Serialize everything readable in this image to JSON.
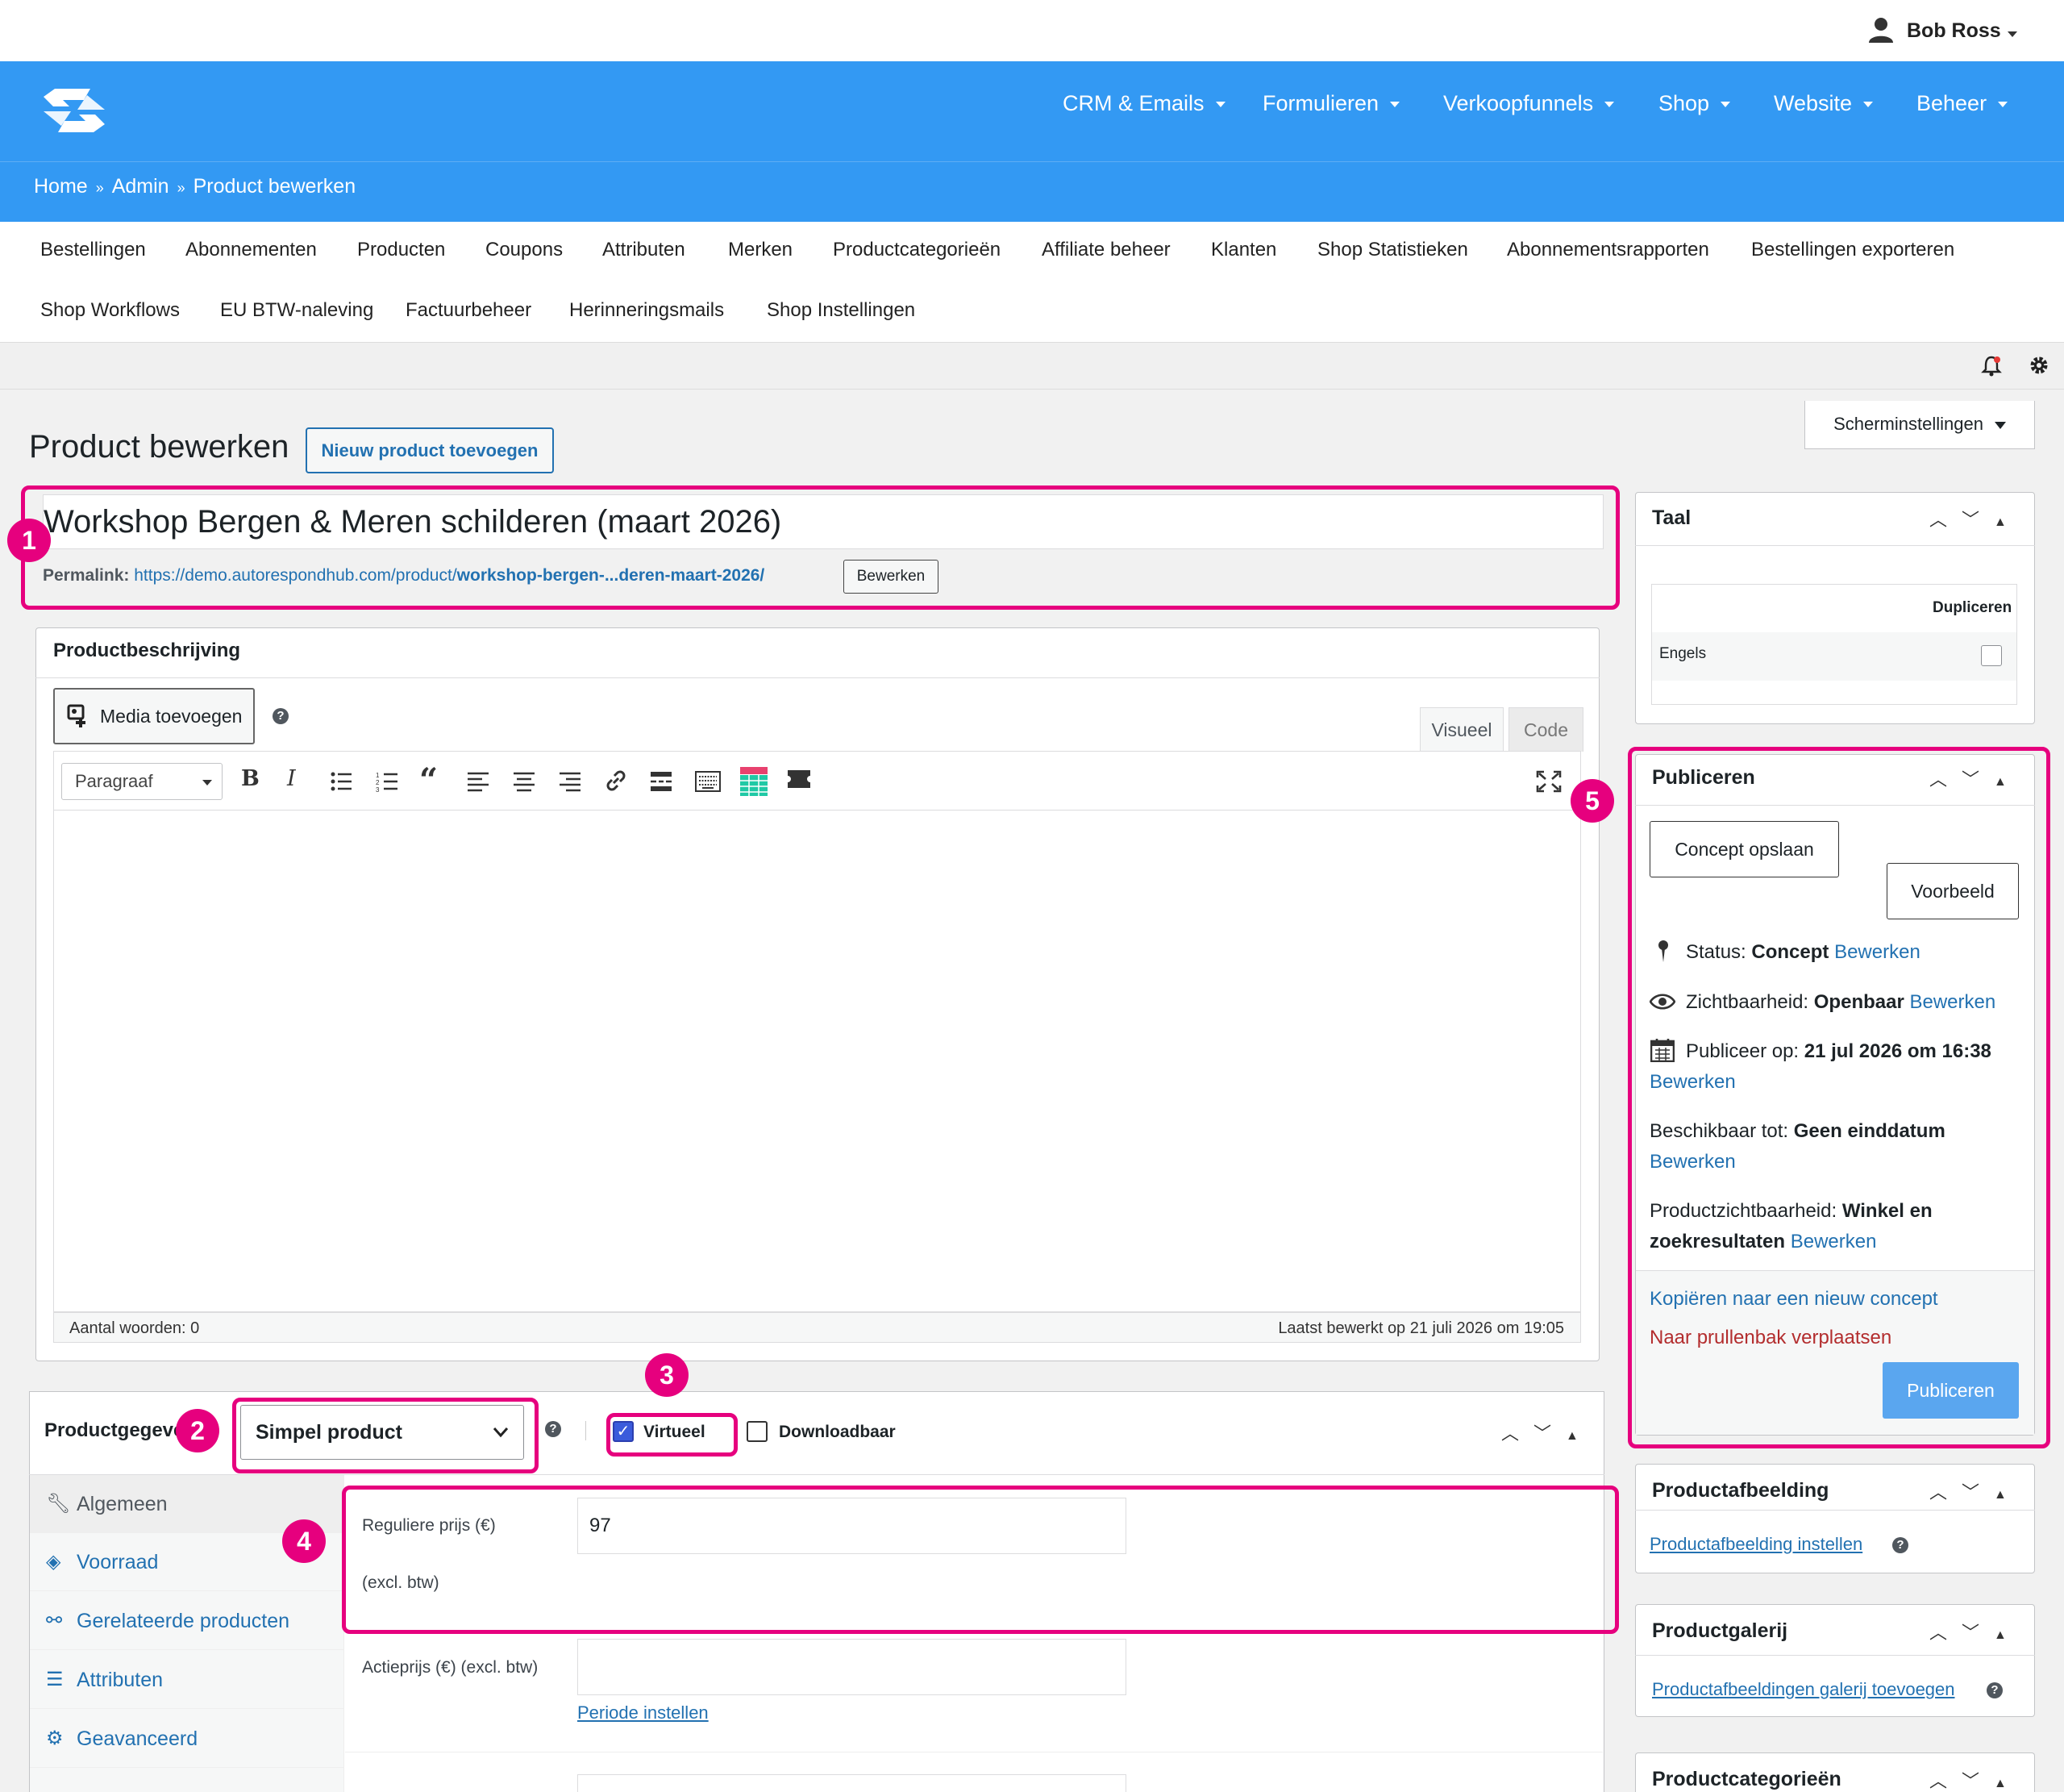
{
  "user": {
    "name": "Bob Ross"
  },
  "topnav": [
    "CRM & Emails",
    "Formulieren",
    "Verkoopfunnels",
    "Shop",
    "Website",
    "Beheer"
  ],
  "breadcrumb": {
    "home": "Home",
    "sep": "»",
    "admin": "Admin",
    "current": "Product bewerken"
  },
  "shopnav": {
    "row1": [
      "Bestellingen",
      "Abonnementen",
      "Producten",
      "Coupons",
      "Attributen",
      "Merken",
      "Productcategorieën",
      "Affiliate beheer",
      "Klanten",
      "Shop Statistieken",
      "Abonnementsrapporten",
      "Bestellingen exporteren"
    ],
    "row2": [
      "Shop Workflows",
      "EU BTW-naleving",
      "Factuurbeheer",
      "Herinneringsmails",
      "Shop Instellingen"
    ]
  },
  "screen_options": "Scherminstellingen",
  "page": {
    "title": "Product bewerken",
    "new_button": "Nieuw product toevoegen"
  },
  "product": {
    "title": "Workshop Bergen & Meren schilderen (maart 2026)",
    "permalink_label": "Permalink:",
    "permalink_base": "https://demo.autorespondhub.com/product/",
    "permalink_slug": "workshop-bergen-...deren-maart-2026/",
    "permalink_button": "Bewerken"
  },
  "description": {
    "heading": "Productbeschrijving",
    "media_button": "Media toevoegen",
    "tab_visual": "Visueel",
    "tab_code": "Code",
    "format": "Paragraaf",
    "word_count": "Aantal woorden: 0",
    "last_edited": "Laatst bewerkt op 21 juli 2026 om 19:05"
  },
  "product_data": {
    "heading": "Productgegevens",
    "type": "Simpel product",
    "virtual_label": "Virtueel",
    "virtual_checked": true,
    "downloadable_label": "Downloadbaar",
    "downloadable_checked": false,
    "tabs": [
      "Algemeen",
      "Voorraad",
      "Gerelateerde producten",
      "Attributen",
      "Geavanceerd"
    ],
    "regular_price_label": "Reguliere prijs (€)",
    "regular_price_note": "(excl. btw)",
    "regular_price": "97",
    "sale_price_label": "Actieprijs (€) (excl. btw)",
    "sale_price": "",
    "schedule_link": "Periode instellen"
  },
  "language_box": {
    "heading": "Taal",
    "col_header": "Dupliceren",
    "language": "Engels"
  },
  "publish_box": {
    "heading": "Publiceren",
    "save_draft": "Concept opslaan",
    "preview": "Voorbeeld",
    "status_label": "Status:",
    "status_value": "Concept",
    "visibility_label": "Zichtbaarheid:",
    "visibility_value": "Openbaar",
    "publish_label": "Publiceer op:",
    "publish_value": "21 jul 2026 om 16:38",
    "available_label": "Beschikbaar tot:",
    "available_value": "Geen einddatum",
    "catalog_label": "Productzichtbaarheid:",
    "catalog_value_1": "Winkel en",
    "catalog_value_2": "zoekresultaten",
    "edit_link": "Bewerken",
    "copy_link": "Kopiëren naar een nieuw concept",
    "trash_link": "Naar prullenbak verplaatsen",
    "publish_button": "Publiceren"
  },
  "image_box": {
    "heading": "Productafbeelding",
    "link": "Productafbeelding instellen"
  },
  "gallery_box": {
    "heading": "Productgalerij",
    "link": "Productafbeeldingen galerij toevoegen"
  },
  "category_box": {
    "heading": "Productcategorieën"
  },
  "annotations": [
    "1",
    "2",
    "3",
    "4",
    "5"
  ],
  "colors": {
    "header_blue": "#3399f3",
    "highlight": "#e6007e",
    "link": "#2271b1",
    "trash": "#b32d2e",
    "publish_button": "#5aa6ef"
  }
}
